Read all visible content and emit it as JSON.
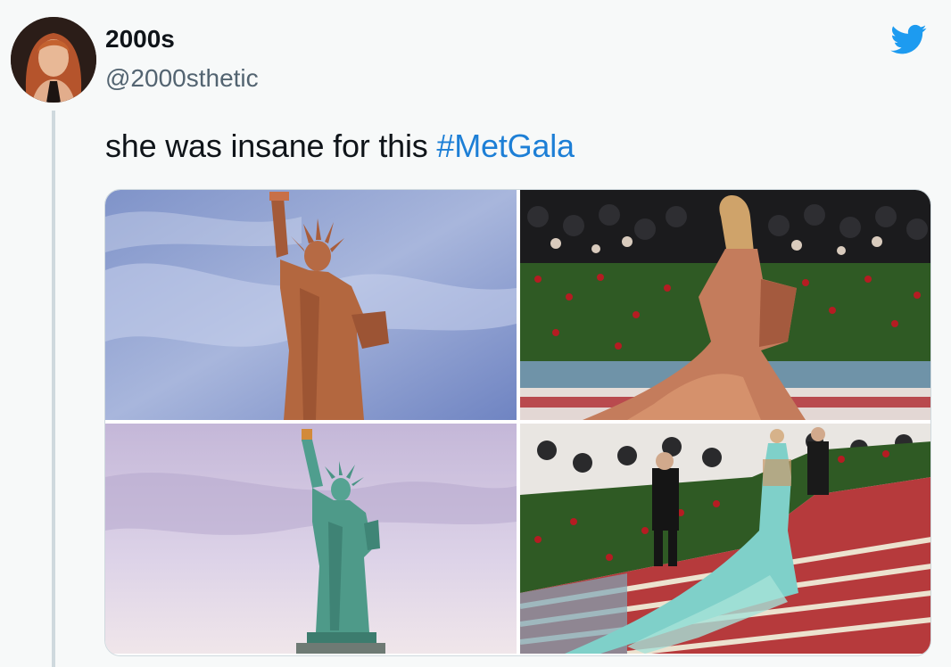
{
  "tweet": {
    "display_name": "2000s",
    "handle": "@2000sthetic",
    "text_plain": "she was insane for this ",
    "text_hashtag": "#MetGala"
  },
  "icons": {
    "brand": "twitter-bird-icon"
  },
  "colors": {
    "twitter_blue": "#1d9bf0",
    "hashtag": "#1d7fd6",
    "text": "#0f1419",
    "secondary_text": "#536471"
  },
  "media": [
    {
      "id": "statue-copper"
    },
    {
      "id": "gala-copper-gown"
    },
    {
      "id": "statue-green"
    },
    {
      "id": "gala-turquoise-gown"
    }
  ]
}
